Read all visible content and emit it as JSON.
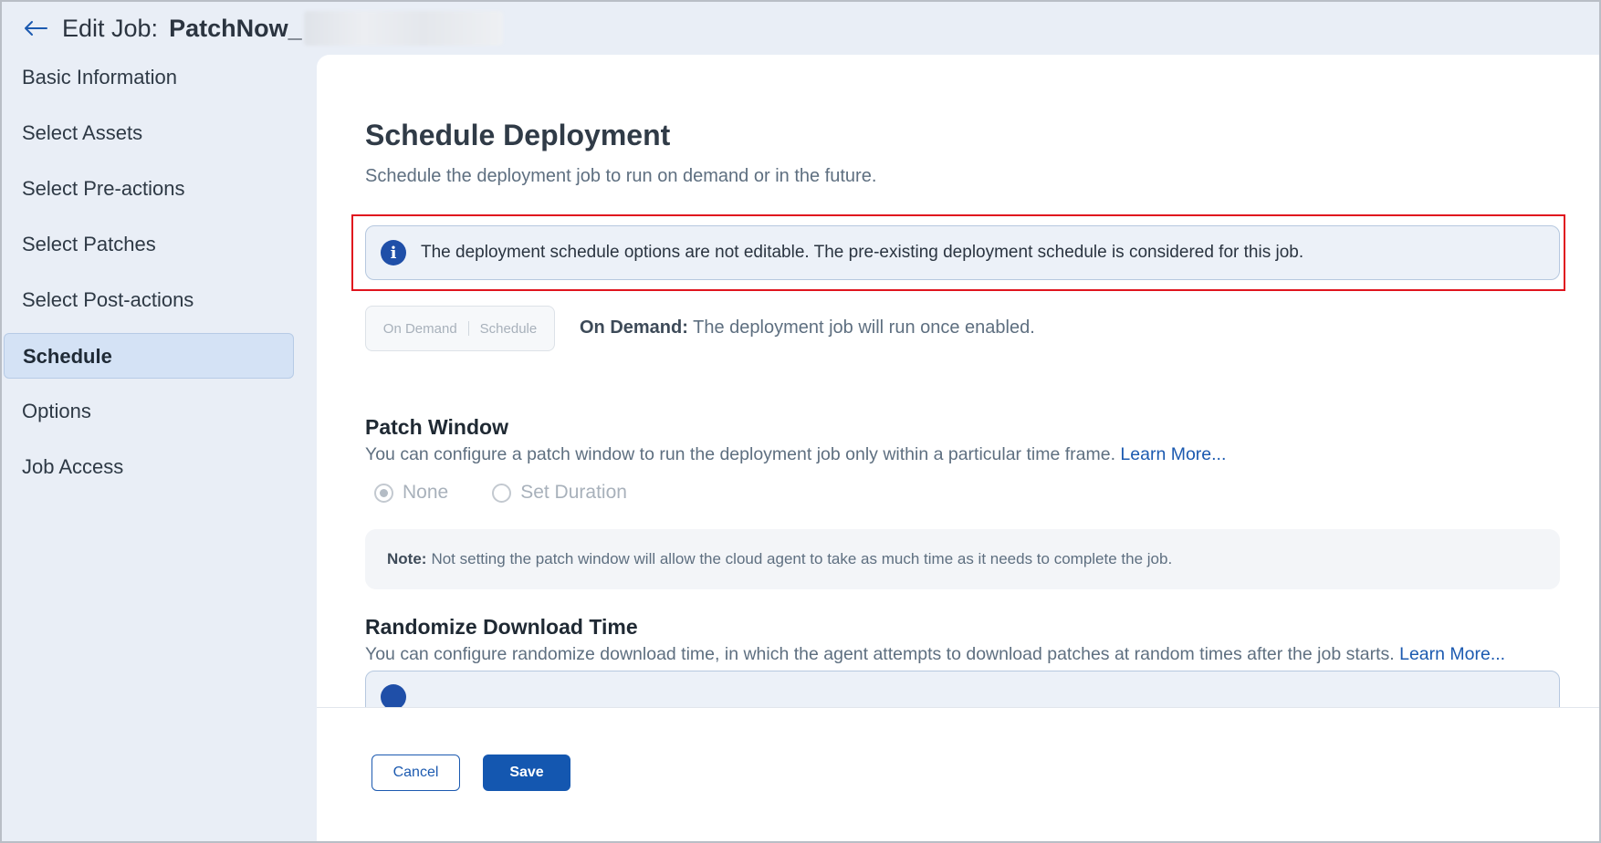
{
  "header": {
    "title": "Edit Job:",
    "job_name": "PatchNow_"
  },
  "sidebar": {
    "items": [
      {
        "label": "Basic Information"
      },
      {
        "label": "Select Assets"
      },
      {
        "label": "Select Pre-actions"
      },
      {
        "label": "Select Patches"
      },
      {
        "label": "Select Post-actions"
      },
      {
        "label": "Schedule",
        "active": true
      },
      {
        "label": "Options"
      },
      {
        "label": "Job Access"
      }
    ]
  },
  "main": {
    "title": "Schedule Deployment",
    "subtitle": "Schedule the deployment job to run on demand or in the future.",
    "info_banner": "The deployment schedule options are not editable. The pre-existing deployment schedule is considered for this job.",
    "schedule_toggle": {
      "options": [
        "On Demand",
        "Schedule"
      ],
      "selected": "On Demand"
    },
    "on_demand_label": "On Demand:",
    "on_demand_desc": "The deployment job will run once enabled.",
    "patch_window": {
      "title": "Patch Window",
      "desc": "You can configure a patch window to run the deployment job only within a particular time frame.",
      "learn_more": "Learn More...",
      "options": [
        "None",
        "Set Duration"
      ],
      "selected": "None",
      "note_label": "Note:",
      "note_text": "Not setting the patch window will allow the cloud agent to take as much time as it needs to complete the job."
    },
    "randomize": {
      "title": "Randomize Download Time",
      "desc": "You can configure randomize download time, in which the agent attempts to download patches at random times after the job starts.",
      "learn_more": "Learn More..."
    }
  },
  "footer": {
    "cancel_label": "Cancel",
    "save_label": "Save"
  },
  "colors": {
    "accent": "#1457b0",
    "highlight_border": "#e0141e",
    "sidebar_active_bg": "#d4e2f5"
  }
}
